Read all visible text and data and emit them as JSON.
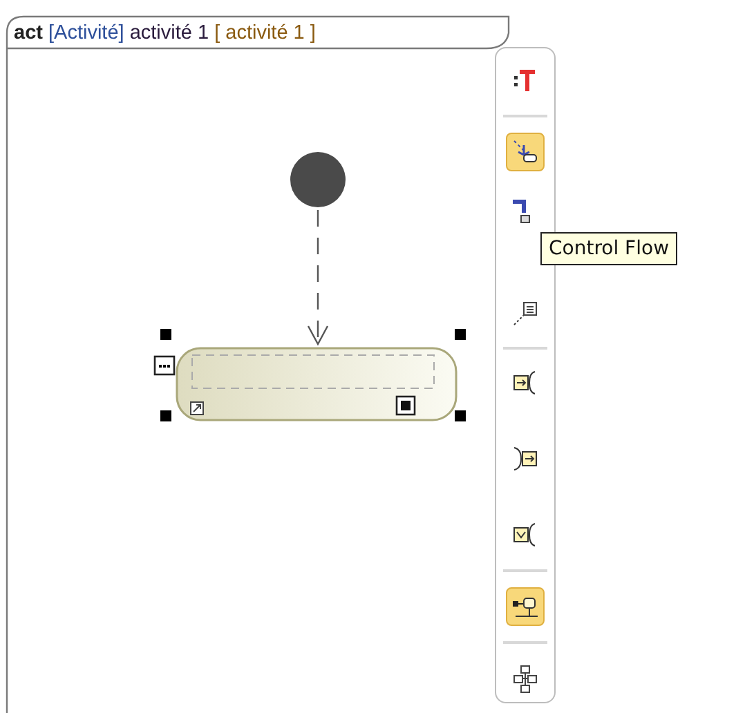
{
  "frame": {
    "title": [
      {
        "kind": "keyword",
        "text": "act"
      },
      {
        "kind": "type",
        "text": "[Activité]"
      },
      {
        "kind": "name",
        "text": "activité 1"
      },
      {
        "kind": "bracket",
        "text": "[ activité 1 ]"
      }
    ]
  },
  "toolbar": [
    {
      "kind": "text",
      "selected": false
    },
    {
      "kind": "separator"
    },
    {
      "kind": "control-flow",
      "selected": true
    },
    {
      "kind": "object-flow",
      "selected": false
    },
    {
      "kind": "note-anchor",
      "selected": false
    },
    {
      "kind": "separator"
    },
    {
      "kind": "input-pin",
      "selected": false
    },
    {
      "kind": "output-pin",
      "selected": false
    },
    {
      "kind": "value-pin",
      "selected": false
    },
    {
      "kind": "separator"
    },
    {
      "kind": "diagram",
      "selected": true
    },
    {
      "kind": "separator"
    },
    {
      "kind": "structure",
      "selected": false
    }
  ],
  "tooltip": "Control Flow"
}
